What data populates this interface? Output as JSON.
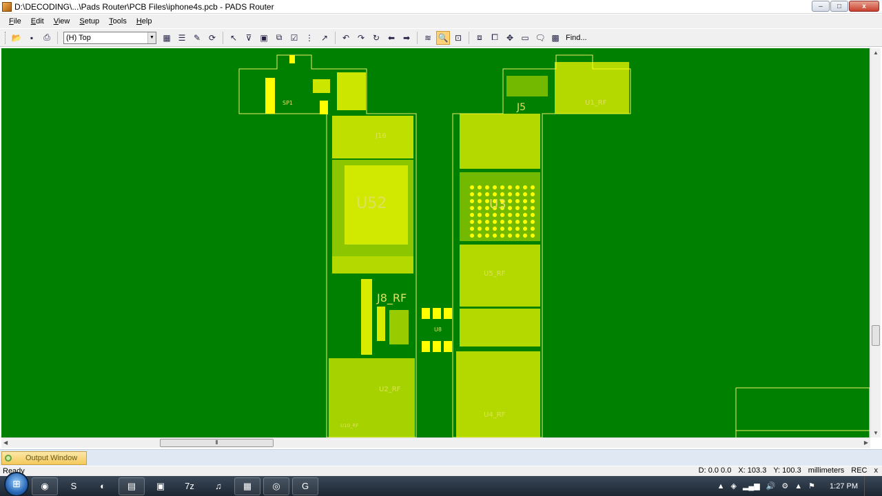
{
  "window": {
    "title": "D:\\DECODING\\...\\Pads Router\\PCB Files\\iphone4s.pcb - PADS Router",
    "minimize": "–",
    "maximize": "□",
    "close": "x"
  },
  "menu": [
    {
      "key": "F",
      "rest": "ile"
    },
    {
      "key": "E",
      "rest": "dit"
    },
    {
      "key": "V",
      "rest": "iew"
    },
    {
      "key": "S",
      "rest": "etup"
    },
    {
      "key": "T",
      "rest": "ools"
    },
    {
      "key": "H",
      "rest": "elp"
    }
  ],
  "toolbar": {
    "layer_value": "(H) Top",
    "find_label": "Find..."
  },
  "board": {
    "labels": [
      "SP1",
      "J16",
      "U52",
      "J8_RF",
      "U8",
      "J5",
      "U1_RF",
      "U2_RF",
      "U10_RF",
      "U5_RF",
      "U4_RF",
      "U3"
    ]
  },
  "output": {
    "tab_label": "Output Window"
  },
  "status": {
    "ready": "Ready",
    "d": "D: 0.0 0.0",
    "x": "X: 103.3",
    "y": "Y: 100.3",
    "units": "millimeters",
    "rec": "REC",
    "x_close": "x"
  },
  "taskbar": {
    "clock": "1:27 PM",
    "apps": [
      "chrome",
      "skype",
      "firefox",
      "explorer",
      "network",
      "7z",
      "itunes",
      "pads",
      "outlook",
      "git"
    ]
  },
  "colors": {
    "board_bg": "#008000",
    "copper": "#ffff00",
    "outline": "#f0f060"
  }
}
